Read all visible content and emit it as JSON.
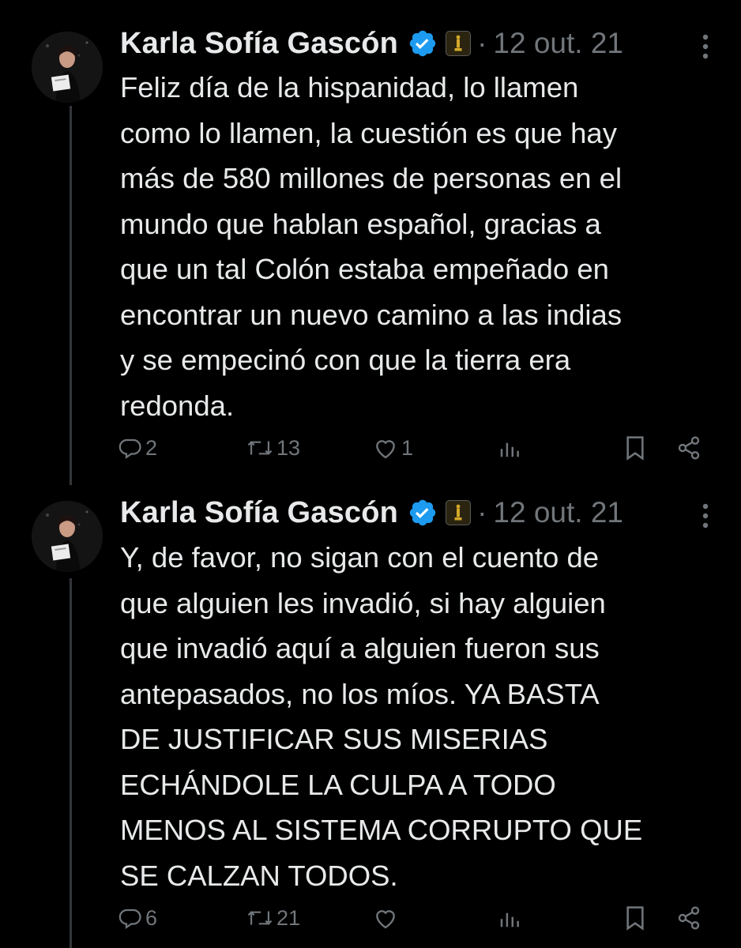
{
  "tweets": [
    {
      "author": "Karla Sofía Gascón",
      "separator": "·",
      "date": "12 out. 21",
      "text": "Feliz día de la hispanidad, lo llamen\ncomo lo llamen, la cuestión es que hay\nmás de 580 millones de personas en el\nmundo que hablan español, gracias a\nque un tal Colón estaba empeñado en\nencontrar un nuevo camino a las indias\ny se empecinó con que la tierra era\nredonda.",
      "replies": "2",
      "retweets": "13",
      "likes": "1"
    },
    {
      "author": "Karla Sofía Gascón",
      "separator": "·",
      "date": "12 out. 21",
      "text": "Y, de favor, no sigan con el cuento de\nque alguien les invadió, si hay alguien\nque invadió aquí a alguien fueron sus\nantepasados, no los míos. YA BASTA\nDE JUSTIFICAR SUS MISERIAS\nECHÁNDOLE LA CULPA A TODO\nMENOS AL SISTEMA CORRUPTO QUE\nSE CALZAN TODOS.",
      "replies": "6",
      "retweets": "21",
      "likes": ""
    }
  ],
  "icons": {
    "verified": "verified-badge-icon",
    "affiliation": "oscar-statuette-icon",
    "more": "more-vertical-icon",
    "reply": "reply-icon",
    "retweet": "retweet-icon",
    "like": "heart-icon",
    "views": "views-icon",
    "bookmark": "bookmark-icon",
    "share": "share-icon"
  },
  "colors": {
    "background": "#000000",
    "text": "#e7e9ea",
    "muted": "#71767b",
    "verified": "#1d9bf0"
  }
}
